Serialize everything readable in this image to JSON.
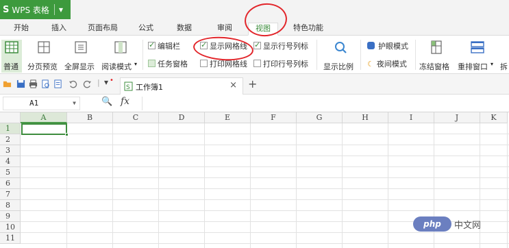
{
  "app": {
    "logo": "S",
    "name": "WPS 表格",
    "brand_color": "#3d9a3d"
  },
  "ribbon_tabs": [
    "开始",
    "插入",
    "页面布局",
    "公式",
    "数据",
    "审阅",
    "视图",
    "特色功能"
  ],
  "active_tab": "视图",
  "ribbon": {
    "view_buttons": [
      "普通",
      "分页预览",
      "全屏显示",
      "阅读模式"
    ],
    "active_view": "普通",
    "checkboxes": [
      {
        "label": "编辑栏",
        "checked": true
      },
      {
        "label": "显示网格线",
        "checked": true
      },
      {
        "label": "显示行号列标",
        "checked": true
      },
      {
        "label": "任务窗格",
        "checked": false
      },
      {
        "label": "打印网格线",
        "checked": false
      },
      {
        "label": "打印行号列标",
        "checked": false
      }
    ],
    "zoom_label": "显示比例",
    "eye_mode": "护眼模式",
    "night_mode": "夜间模式",
    "freeze_label": "冻结窗格",
    "arrange_label": "重排窗口",
    "split_label": "拆"
  },
  "document_tab": {
    "name": "工作簿1",
    "close": "×",
    "add": "+"
  },
  "formula_bar": {
    "cell_ref": "A1",
    "fx_symbol": "fx",
    "zoom_symbol": "🔍"
  },
  "grid": {
    "columns": [
      "A",
      "B",
      "C",
      "D",
      "E",
      "F",
      "G",
      "H",
      "I",
      "J",
      "K"
    ],
    "rows": [
      "1",
      "2",
      "3",
      "4",
      "5",
      "6",
      "7",
      "8",
      "9",
      "10",
      "11"
    ],
    "selected_cell": "A1"
  },
  "watermark": {
    "logo": "php",
    "text": "中文网"
  },
  "annotation_color": "#e2252a"
}
